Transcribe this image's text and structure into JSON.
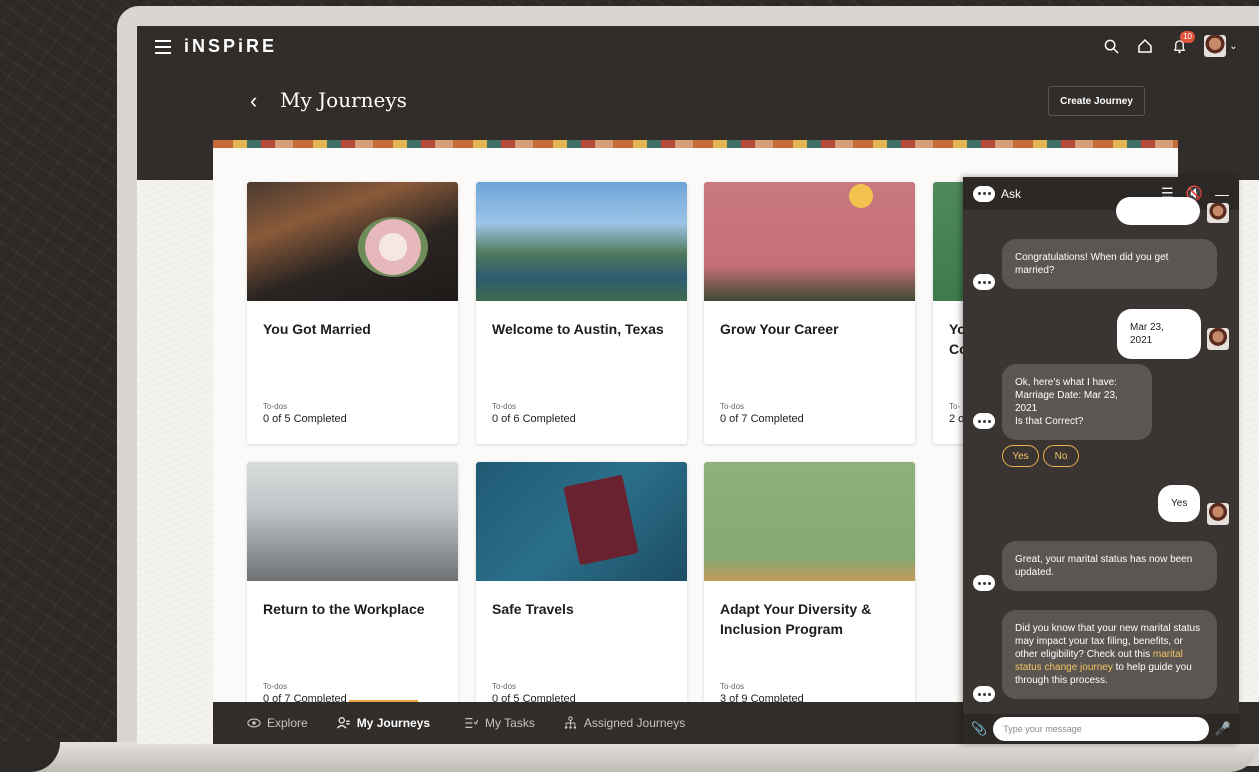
{
  "app": {
    "brand": "iNSPiRE",
    "notification_count": "10"
  },
  "header": {
    "title": "My Journeys",
    "create_button": "Create Journey"
  },
  "cards": [
    {
      "title": "You Got Married",
      "todo_label": "To-dos",
      "todo_value": "0 of 5 Completed"
    },
    {
      "title": "Welcome to Austin, Texas",
      "todo_label": "To-dos",
      "todo_value": "0 of 6 Completed"
    },
    {
      "title": "Grow Your Career",
      "todo_label": "To-dos",
      "todo_value": "0 of 7 Completed"
    },
    {
      "title": "Yo\nCo",
      "todo_label": "To-",
      "todo_value": "2 o"
    },
    {
      "title": "Return to the Workplace",
      "todo_label": "To-dos",
      "todo_value": "0 of 7 Completed"
    },
    {
      "title": "Safe Travels",
      "todo_label": "To-dos",
      "todo_value": "0 of 5 Completed"
    },
    {
      "title": "Adapt Your Diversity & Inclusion Program",
      "todo_label": "To-dos",
      "todo_value": "3 of 9 Completed"
    }
  ],
  "bottom_nav": {
    "explore": "Explore",
    "my_journeys": "My Journeys",
    "my_tasks": "My Tasks",
    "assigned_journeys": "Assigned Journeys"
  },
  "chat": {
    "title": "Ask",
    "messages": {
      "bot1": "Congratulations! When did you get married?",
      "user1": "Mar 23, 2021",
      "bot2_line1": "Ok, here's what I have:",
      "bot2_line2": "Marriage Date: Mar 23, 2021",
      "bot2_line3": "Is that Correct?",
      "chip_yes": "Yes",
      "chip_no": "No",
      "user2": "Yes",
      "bot3": "Great, your marital status has now been updated.",
      "bot4_pre": "Did you know that your new marital status may impact your tax filing, benefits, or other eligibility? Check out this ",
      "bot4_link": "marital status change journey",
      "bot4_post": " to help guide you through this process."
    },
    "input_placeholder": "Type your message"
  }
}
